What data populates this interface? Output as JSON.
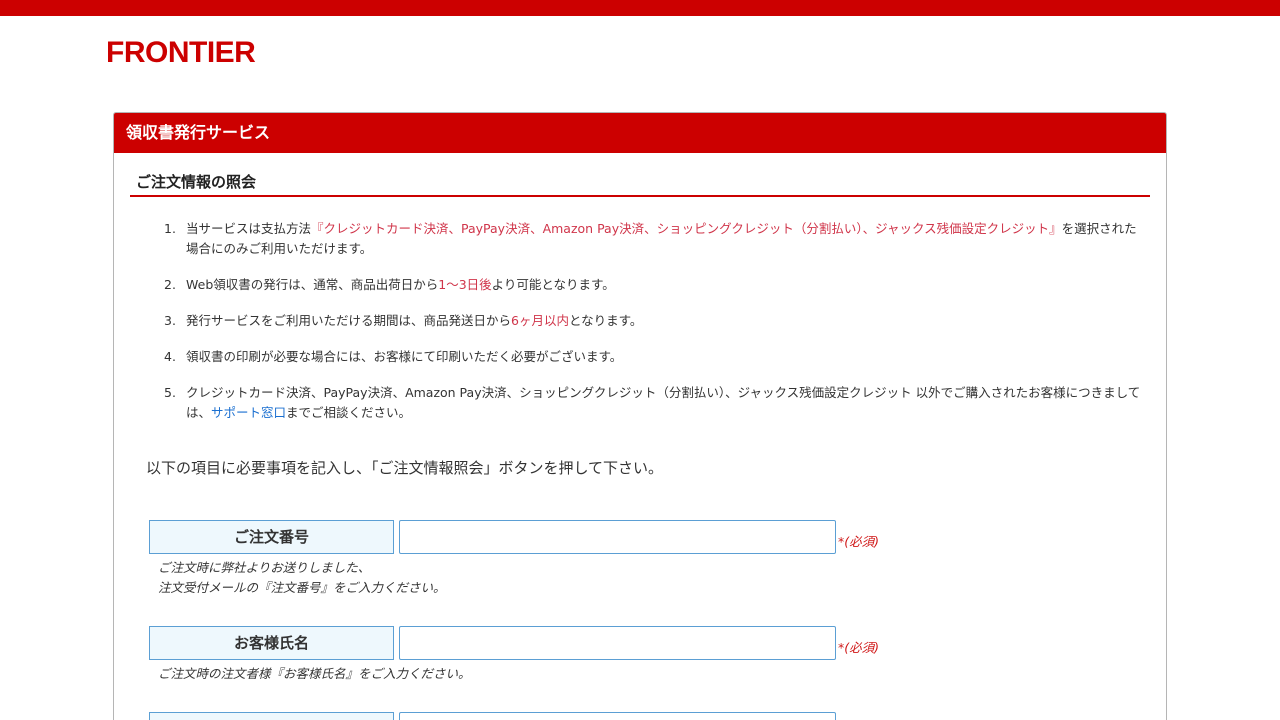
{
  "brand": {
    "logo": "FRONTIER"
  },
  "panel": {
    "header": "領収書発行サービス",
    "section_title": "ご注文情報の照会"
  },
  "notes": [
    {
      "num": "1.",
      "pre": "当サービスは支払方法",
      "highlight": "『クレジットカード決済、PayPay決済、Amazon Pay決済、ショッピングクレジット（分割払い）、ジャックス残価設定クレジット』",
      "post": "を選択された場合にのみご利用いただけます。"
    },
    {
      "num": "2.",
      "pre": "Web領収書の発行は、通常、商品出荷日から",
      "highlight": "1〜3日後",
      "post": "より可能となります。"
    },
    {
      "num": "3.",
      "pre": "発行サービスをご利用いただける期間は、商品発送日から",
      "highlight": "6ヶ月以内",
      "post": "となります。"
    },
    {
      "num": "4.",
      "text": "領収書の印刷が必要な場合には、お客様にて印刷いただく必要がございます。"
    },
    {
      "num": "5.",
      "pre": "クレジットカード決済、PayPay決済、Amazon Pay決済、ショッピングクレジット（分割払い）、ジャックス残価設定クレジット 以外でご購入されたお客様につきましては、",
      "link": "サポート窓口",
      "post": "までご相談ください。"
    }
  ],
  "instruction": "以下の項目に必要事項を記入し、「ご注文情報照会」ボタンを押して下さい。",
  "form": {
    "order_number": {
      "label": "ご注文番号",
      "value": "",
      "required": "*(必須)",
      "hint_line1": "ご注文時に弊社よりお送りしました、",
      "hint_line2": "注文受付メールの『注文番号』をご入力ください。"
    },
    "customer_name": {
      "label": "お客様氏名",
      "value": "",
      "required": "*(必須)",
      "hint_line1": "ご注文時の注文者様『お客様氏名』をご入力ください。"
    },
    "third_field": {
      "label": "",
      "value": ""
    }
  },
  "colors": {
    "brand_red": "#cc0000",
    "highlight_red": "#d0354a",
    "link_blue": "#1a6fd0",
    "label_bg": "#eef8fd",
    "field_border": "#5b9fd4"
  }
}
